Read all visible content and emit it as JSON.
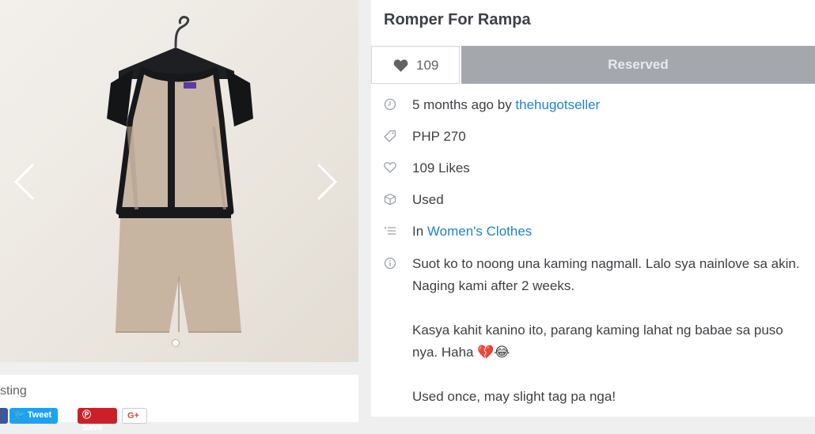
{
  "listing": {
    "title": "Romper For Rampa",
    "likes_count": "109",
    "status_label": "Reserved"
  },
  "meta": {
    "time_ago": "5 months ago by ",
    "seller": "thehugotseller",
    "price": "PHP 270",
    "likes_text": "109 Likes",
    "condition": "Used",
    "category_prefix": "In ",
    "category": "Women's Clothes"
  },
  "description": {
    "line1": "Suot ko to noong una kaming nagmall. Lalo sya nainlove sa akin. Naging kami after 2 weeks.",
    "line2": "Kasya kahit kanino ito, parang kaming lahat ng babae sa puso nya. Haha 💔😂",
    "line3": "Used once, may slight tag pa nga!"
  },
  "share": {
    "label": "sting",
    "facebook": "f",
    "tweet": "🐦 Tweet",
    "save": "Ⓟ Save",
    "gplus": "G+"
  },
  "carousel": {
    "slide_count": 1
  },
  "colors": {
    "link": "#1f84c4",
    "status_bg": "#a4a8ad",
    "text": "#3d4044",
    "icon": "#9aa0a6"
  },
  "icons": {
    "prev": "chevron-left-icon",
    "next": "chevron-right-icon",
    "clock": "clock-icon",
    "price": "price-tag-icon",
    "likes": "heart-outline-icon",
    "condition": "box-icon",
    "category": "list-icon",
    "info": "info-icon"
  }
}
